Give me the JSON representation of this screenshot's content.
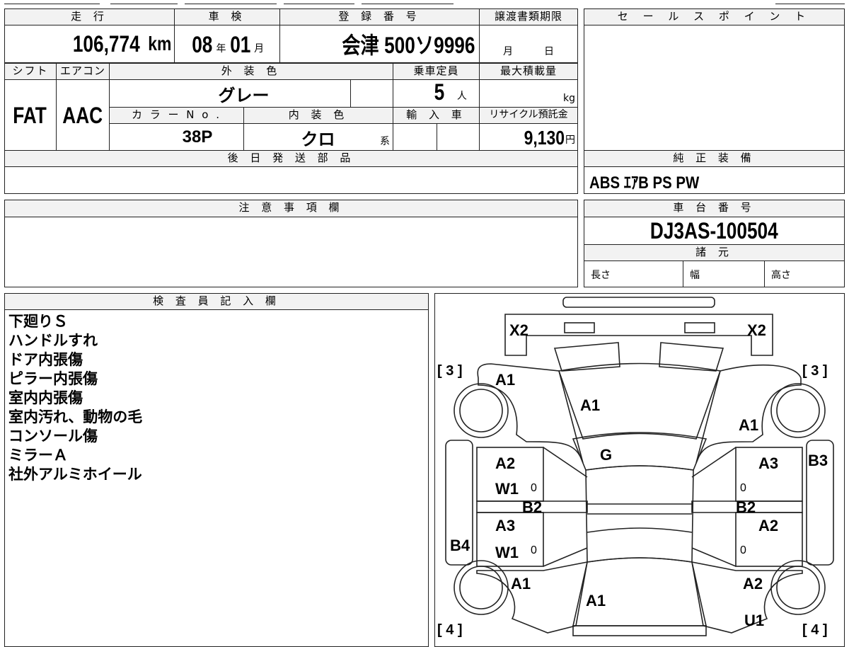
{
  "top": {
    "mileage_label": "走 行",
    "mileage_value": "106,774",
    "mileage_unit": "km",
    "inspection_label": "車 検",
    "inspection_year": "08",
    "inspection_year_unit": "年",
    "inspection_month": "01",
    "inspection_month_unit": "月",
    "registration_label": "登 録 番 号",
    "registration_value": "会津 500ソ9996",
    "transfer_label": "譲渡書類期限",
    "transfer_month": "月",
    "transfer_day": "日"
  },
  "row2": {
    "shift_label": "シフト",
    "shift_value": "FAT",
    "ac_label": "エアコン",
    "ac_value": "AAC",
    "exterior_label": "外 装 色",
    "exterior_value": "グレー",
    "capacity_label": "乗車定員",
    "capacity_value": "5",
    "capacity_unit": "人",
    "maxload_label": "最大積載量",
    "maxload_unit": "kg",
    "color_no_label": "カ ラ ー N o .",
    "color_no_value": "38P",
    "interior_label": "内 装 色",
    "interior_value": "クロ",
    "interior_unit": "系",
    "import_label": "輸 入 車",
    "recycle_label": "リサイクル預託金",
    "recycle_value": "9,130",
    "recycle_unit": "円"
  },
  "later_parts": {
    "label": "後 日 発 送 部 品"
  },
  "sales_point": {
    "label": "セ ー ル ス ポ イ ン ト"
  },
  "genuine": {
    "label": "純 正 装 備",
    "value": "ABS ｴｱB PS PW"
  },
  "caution": {
    "label": "注 意 事 項 欄"
  },
  "chassis": {
    "label": "車 台 番 号",
    "value": "DJ3AS-100504"
  },
  "specs": {
    "label": "諸 元",
    "length": "長さ",
    "width": "幅",
    "height": "高さ"
  },
  "inspector": {
    "label": "検 査 員 記 入 欄",
    "lines": [
      "下廻りＳ",
      "ハンドルすれ",
      "ドア内張傷",
      "ピラー内張傷",
      "室内内張傷",
      "室内汚れ、動物の毛",
      "コンソール傷",
      "ミラーＡ",
      "社外アルミホイール"
    ]
  },
  "diagram": {
    "x2_left": "X2",
    "x2_right": "X2",
    "tire_fl": "[ 3 ]",
    "tire_fr": "[ 3 ]",
    "tire_rl": "[ 4 ]",
    "tire_rr": "[ 4 ]",
    "a1_fender_l": "A1",
    "a1_hood": "A1",
    "a1_fender_r": "A1",
    "g_windshield": "G",
    "a2_door_fl": "A2",
    "w1_fl": "W1",
    "a3_door_fr": "A3",
    "b2_left": "B2",
    "b2_right": "B2",
    "b3_right": "B3",
    "a3_door_rl": "A3",
    "w1_rl": "W1",
    "a2_door_rr": "A2",
    "b4_left": "B4",
    "a1_quarter_l": "A1",
    "a1_rear": "A1",
    "a2_quarter_r": "A2",
    "u1_quarter_r": "U1",
    "mark_zero": "0"
  }
}
